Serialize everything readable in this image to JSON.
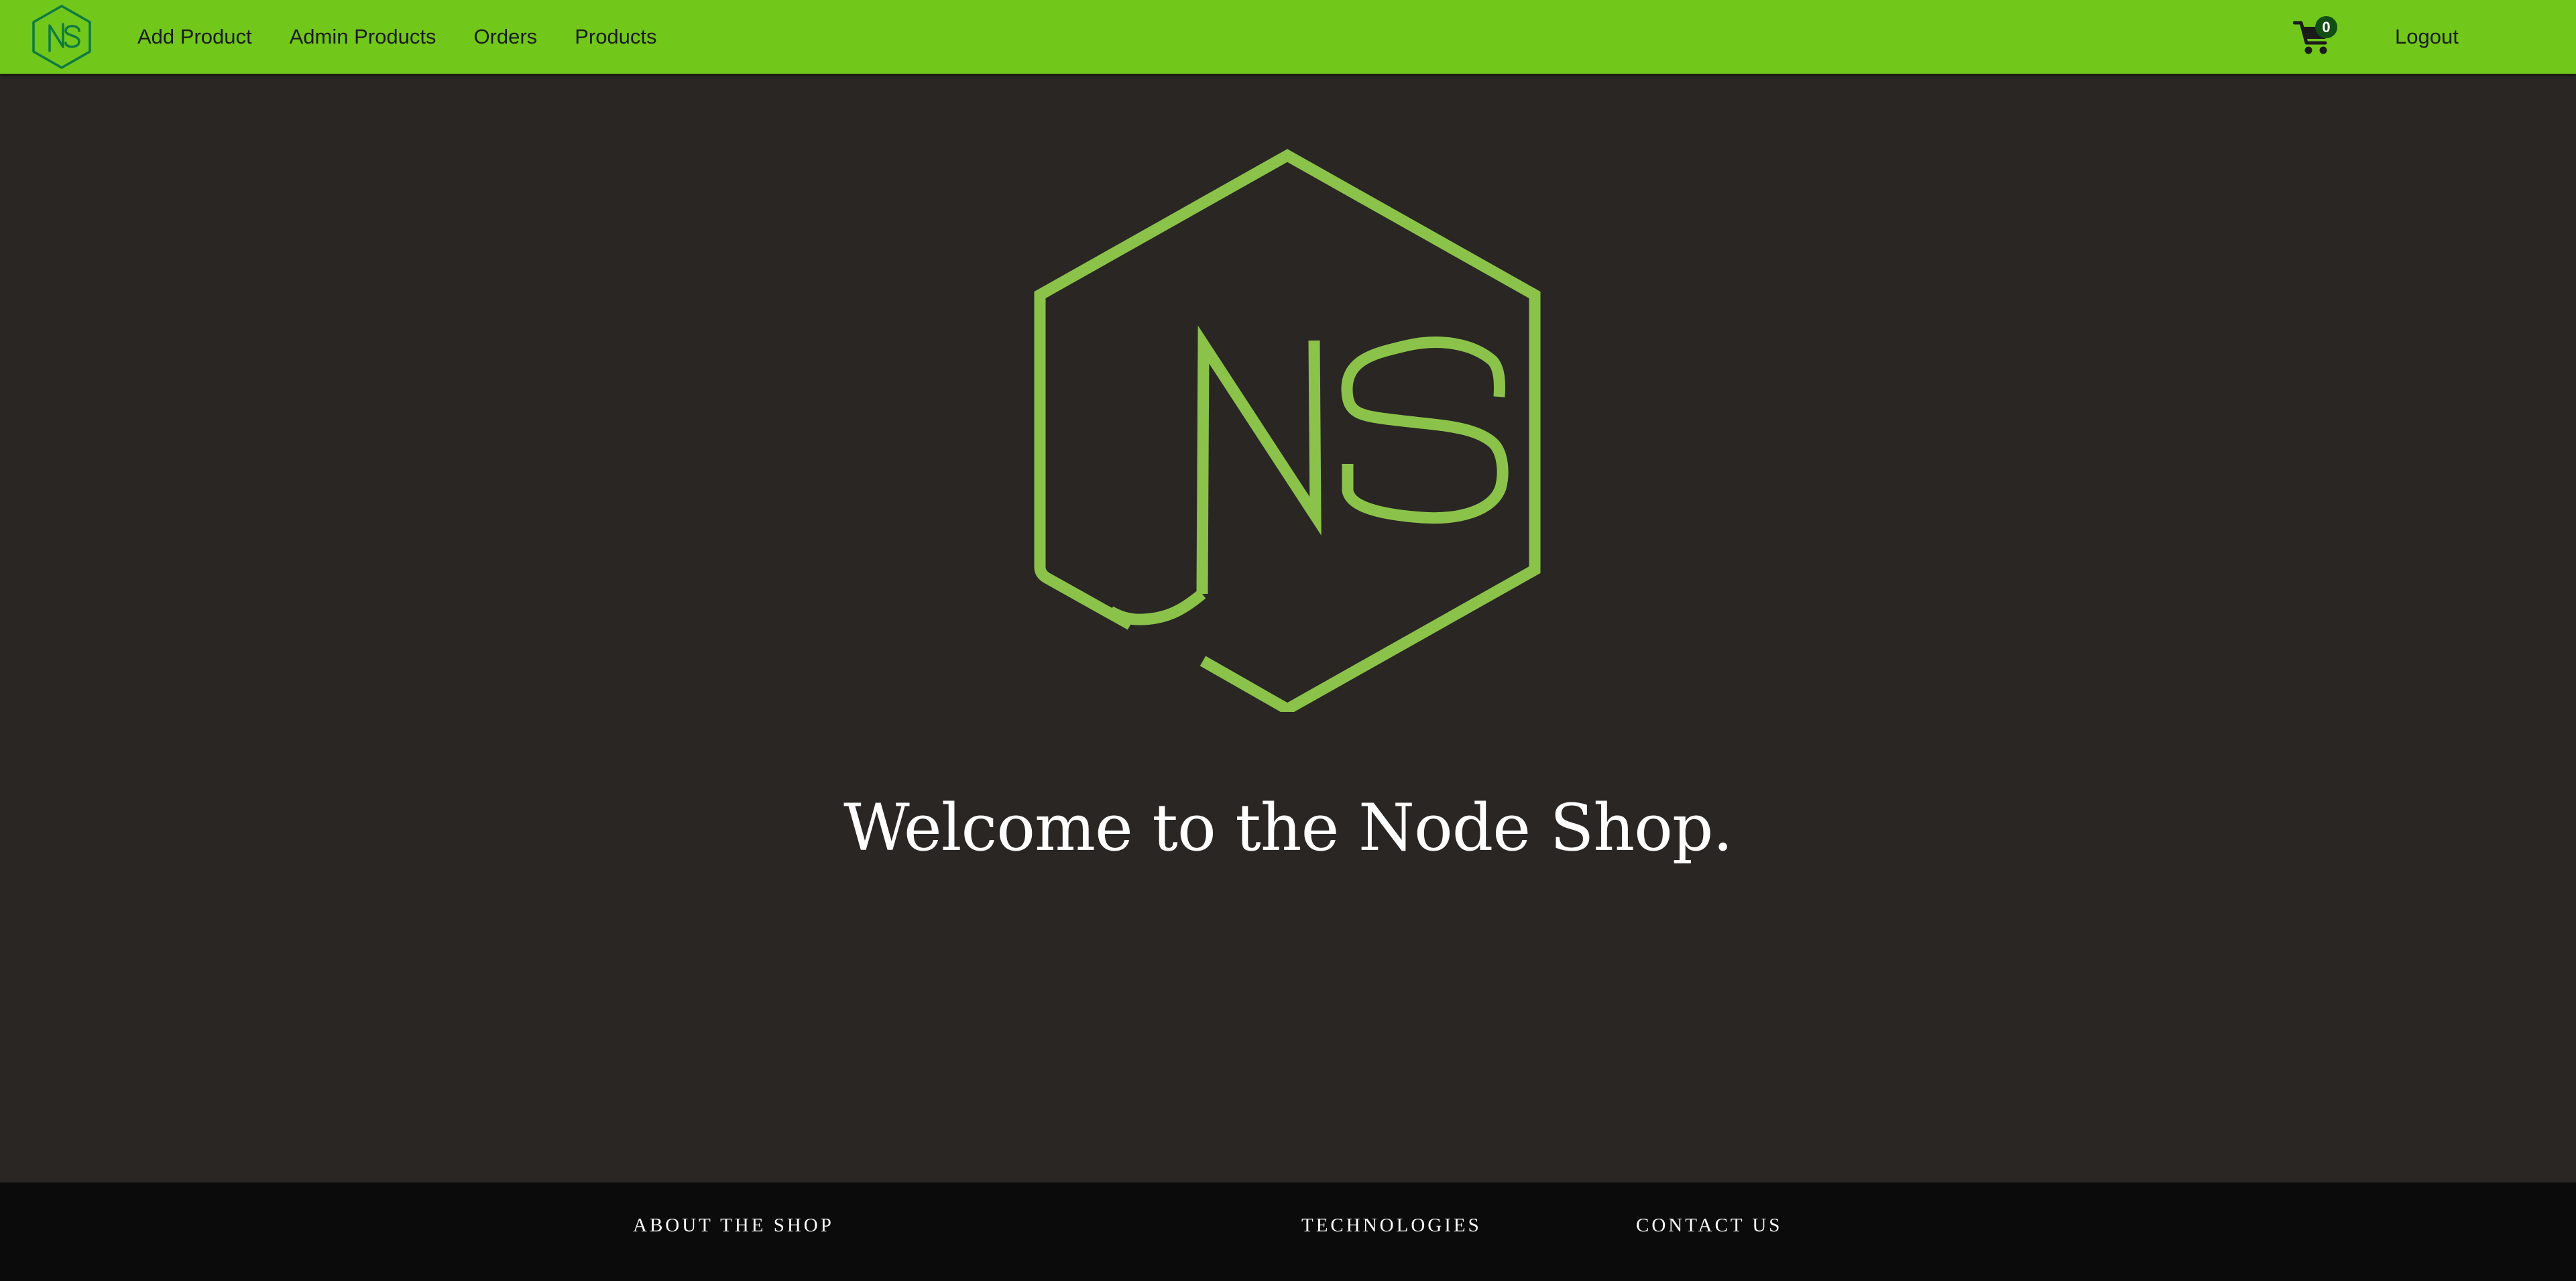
{
  "navbar": {
    "logo_text": "NS",
    "links": [
      {
        "label": "Add Product"
      },
      {
        "label": "Admin Products"
      },
      {
        "label": "Orders"
      },
      {
        "label": "Products"
      }
    ],
    "cart_count": "0",
    "logout_label": "Logout",
    "cart_icon": "shopping-cart-icon"
  },
  "hero": {
    "logo_text": "NS",
    "title": "Welcome to the Node Shop."
  },
  "footer": {
    "about_label": "About the Shop",
    "technologies_label": "Technologies",
    "contact_label": "Contact Us"
  },
  "colors": {
    "navbar_bg": "#71c71a",
    "page_bg": "#2a2624",
    "accent_green": "#8bc34a",
    "footer_bg": "#0b0b0b",
    "badge_bg": "#124d12",
    "nav_logo_color": "#0e7a43"
  }
}
